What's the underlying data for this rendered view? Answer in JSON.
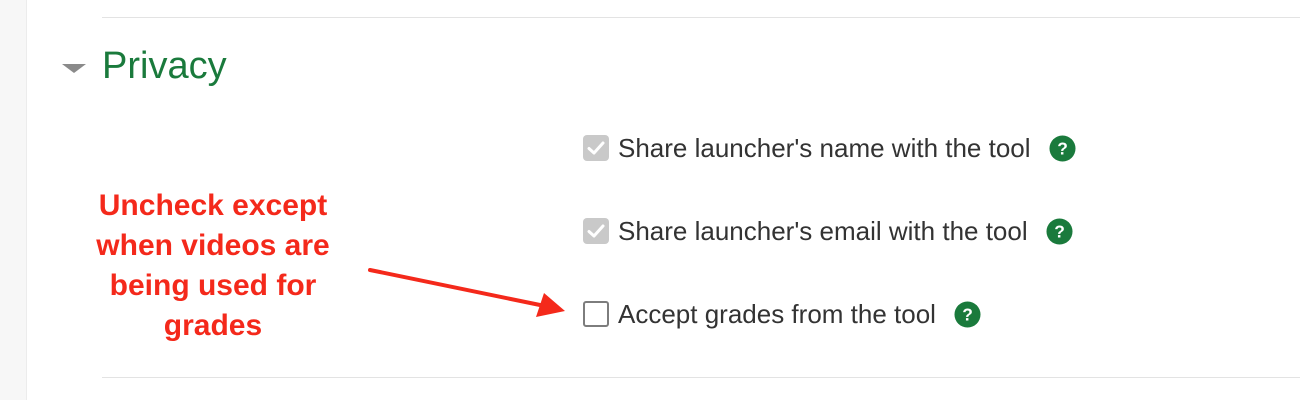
{
  "section": {
    "title": "Privacy",
    "title_color": "#1a7a3c"
  },
  "options": [
    {
      "label": "Share launcher's name with the tool",
      "checked": true,
      "help_icon": "question-circle-icon"
    },
    {
      "label": "Share launcher's email with the tool",
      "checked": true,
      "help_icon": "question-circle-icon"
    },
    {
      "label": "Accept grades from the tool",
      "checked": false,
      "help_icon": "question-circle-icon"
    }
  ],
  "annotation": {
    "lines": [
      "Uncheck except",
      "when videos are",
      "being used for",
      "grades"
    ],
    "color": "#f4291b"
  },
  "colors": {
    "help_icon": "#1a7a3c",
    "checked_box": "#c9c9c9"
  }
}
